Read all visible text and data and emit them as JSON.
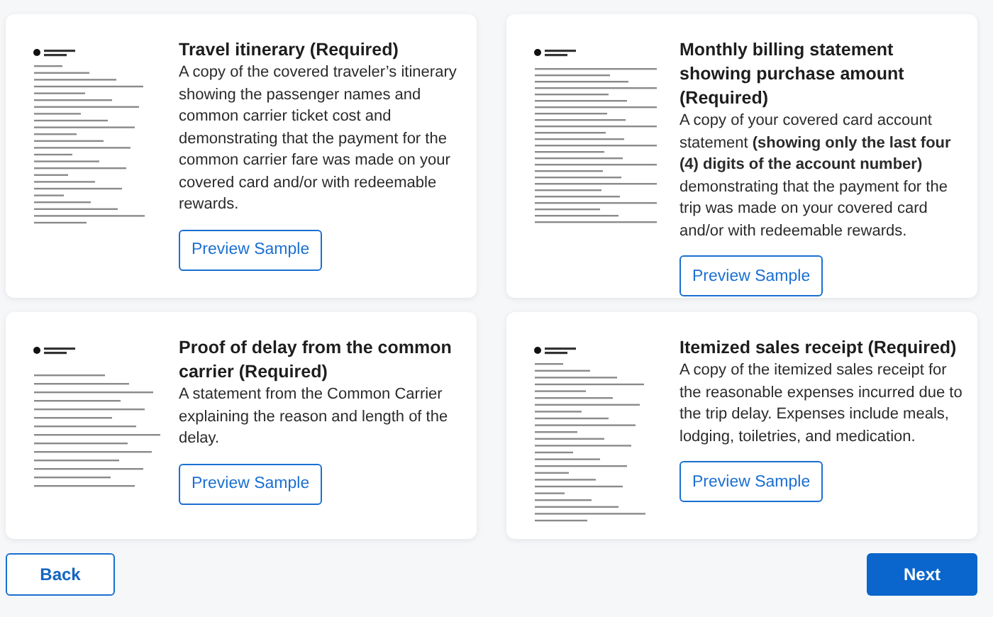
{
  "documents": [
    {
      "title": "Travel itinerary (Required)",
      "description": "A copy of the covered traveler’s itinerary showing the passenger names and common carrier ticket cost and demonstrating that the payment for the common carrier fare was made on your covered card and/or with redeemable rewards.",
      "button": "Preview Sample",
      "kind": "receipt"
    },
    {
      "title": "Monthly billing statement showing purchase amount (Required)",
      "description": "A copy of your covered card account statement **(showing only the last four (4) digits of the account number)** demonstrating that the payment for the trip was made on your covered card and/or with redeemable rewards.",
      "button": "Preview Sample",
      "kind": "statement"
    },
    {
      "title": "Proof of delay from the common carrier (Required)",
      "description": "A statement from the Common Carrier explaining the reason and length of the delay.",
      "button": "Preview Sample",
      "kind": "letter"
    },
    {
      "title": "Itemized sales receipt (Required)",
      "description": "A copy of the itemized sales receipt for the reasonable expenses incurred due to the trip delay. Expenses include meals, lodging, toiletries, and medication.",
      "button": "Preview Sample",
      "kind": "receipt"
    }
  ],
  "back_button": "Back",
  "next_button": "Next"
}
